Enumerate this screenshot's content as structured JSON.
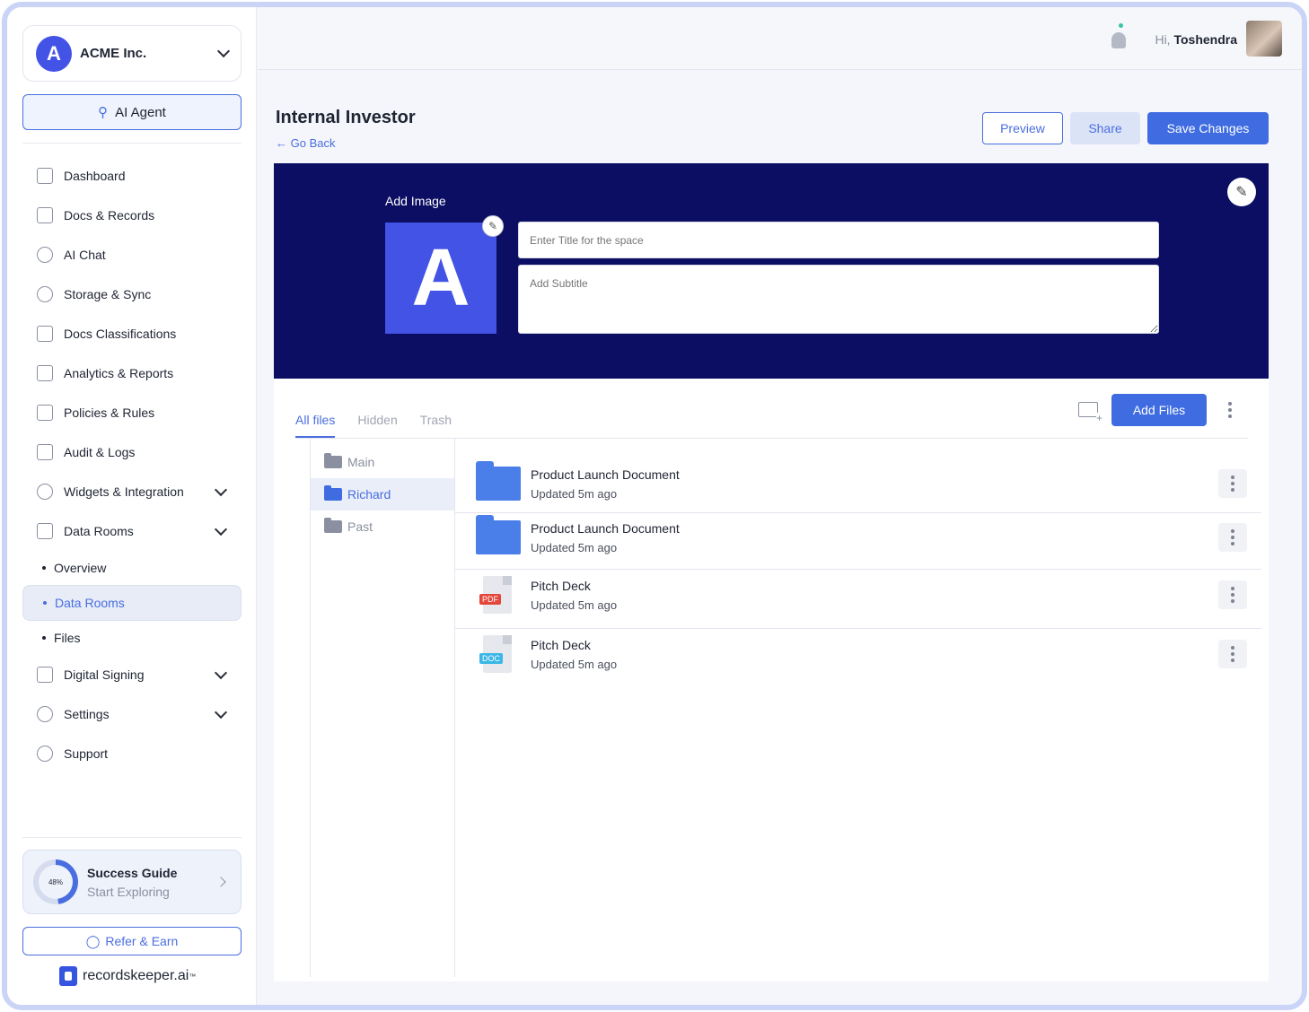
{
  "org": {
    "name": "ACME Inc.",
    "logo_letter": "A"
  },
  "ai_agent_label": "AI Agent",
  "nav": {
    "items": [
      {
        "label": "Dashboard",
        "icon": "dashboard-icon"
      },
      {
        "label": "Docs & Records",
        "icon": "docs-icon"
      },
      {
        "label": "AI Chat",
        "icon": "ai-chat-icon"
      },
      {
        "label": "Storage & Sync",
        "icon": "cloud-sync-icon"
      },
      {
        "label": "Docs Classifications",
        "icon": "hierarchy-icon"
      },
      {
        "label": "Analytics & Reports",
        "icon": "clipboard-icon"
      },
      {
        "label": "Policies & Rules",
        "icon": "policy-icon"
      },
      {
        "label": "Audit & Logs",
        "icon": "log-icon"
      },
      {
        "label": "Widgets & Integration",
        "icon": "widgets-icon"
      },
      {
        "label": "Data Rooms",
        "icon": "data-icon"
      }
    ],
    "data_rooms_sub": [
      "Overview",
      "Data Rooms",
      "Files"
    ],
    "bottom_items": [
      {
        "label": "Digital Signing",
        "icon": "signing-icon"
      },
      {
        "label": "Settings",
        "icon": "gear-icon"
      },
      {
        "label": "Support",
        "icon": "help-icon"
      }
    ]
  },
  "success_guide": {
    "title": "Success Guide",
    "subtitle": "Start Exploring",
    "progress_label": "48%",
    "progress": 0.48
  },
  "refer_label": "Refer & Earn",
  "brand": {
    "name": "recordskeeper.ai",
    "tm": "™"
  },
  "header": {
    "greeting": "Hi,",
    "user": "Toshendra"
  },
  "page": {
    "title": "Internal Investor",
    "go_back": "Go Back"
  },
  "actions": {
    "preview": "Preview",
    "share": "Share",
    "save": "Save Changes"
  },
  "banner": {
    "add_image": "Add Image",
    "logo_letter": "A",
    "title_placeholder": "Enter Title for the space",
    "subtitle_placeholder": "Add Subtitle"
  },
  "tabs": [
    "All files",
    "Hidden",
    "Trash"
  ],
  "add_files": "Add Files",
  "folders": [
    "Main",
    "Richard",
    "Past"
  ],
  "files": [
    {
      "name": "Product Launch Document",
      "meta": "Updated 5m ago",
      "type": "folder"
    },
    {
      "name": "Product Launch Document",
      "meta": "Updated 5m ago",
      "type": "folder"
    },
    {
      "name": "Pitch Deck",
      "meta": "Updated 5m ago",
      "type": "PDF"
    },
    {
      "name": "Pitch Deck",
      "meta": "Updated 5m ago",
      "type": "DOC"
    }
  ],
  "colors": {
    "accent": "#3f6ce1",
    "banner": "#0b0e63",
    "logo": "#4353e6",
    "pdf": "#e4463a",
    "doc": "#3bb7e6"
  }
}
